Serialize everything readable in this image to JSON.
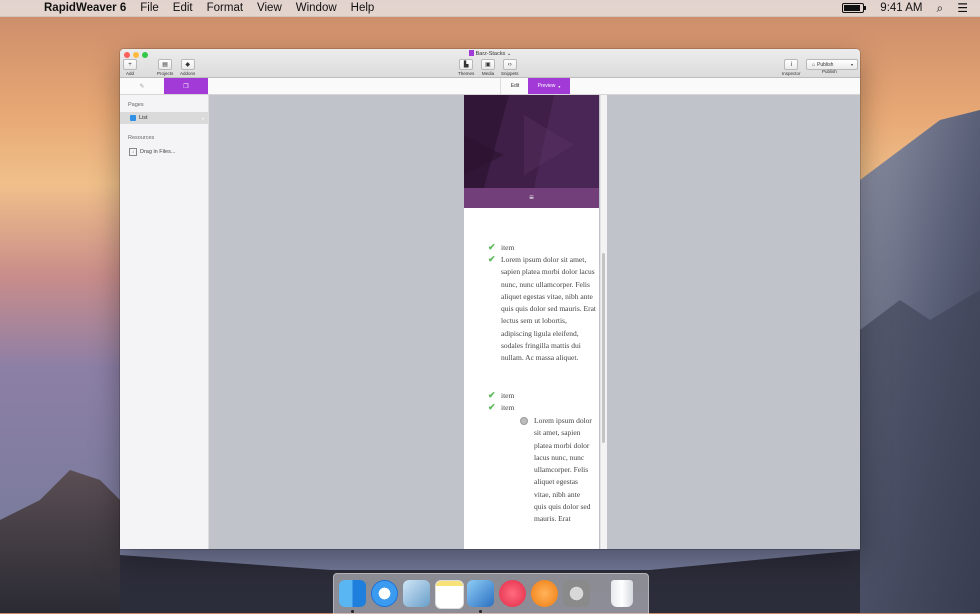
{
  "menubar": {
    "app_name": "RapidWeaver 6",
    "menus": [
      "File",
      "Edit",
      "Format",
      "View",
      "Window",
      "Help"
    ],
    "clock": "9:41 AM",
    "battery_level": 0.85
  },
  "window": {
    "title": "Barz-Stacks",
    "toolbar": {
      "add": "Add",
      "projects": "Projects",
      "addons": "Addons",
      "themes": "Themes",
      "media": "Media",
      "snippets": "Snippets",
      "inspector": "Inspector",
      "publish_button": "Publish",
      "publish_label": "Publish"
    },
    "tabs": {
      "edit": "Edit",
      "preview": "Preview"
    },
    "sidebar": {
      "pages_header": "Pages",
      "page_item": "List",
      "resources_header": "Resources",
      "drag_files": "Drag in Files..."
    }
  },
  "preview": {
    "list": [
      "item",
      "Lorem ipsum dolor sit amet, sapien platea morbi dolor lacus nunc, nunc ullamcorper. Felis aliquet egestas vitae, nibh ante quis quis dolor sed mauris. Erat lectus sem ut lobortis, adipiscing ligula eleifend, sodales fringilla mattis dui nullam. Ac massa aliquet.",
      "item",
      "item"
    ],
    "nested_item": "Lorem ipsum dolor sit amet, sapien platea morbi dolor lacus nunc, nunc ullamcorper. Felis aliquet egestas vitae, nibh ante quis quis dolor sed mauris. Erat"
  },
  "colors": {
    "accent": "#a23ad7",
    "check": "#5cb85c",
    "nav": "#733f7b",
    "hero": "#3a1b3e"
  }
}
